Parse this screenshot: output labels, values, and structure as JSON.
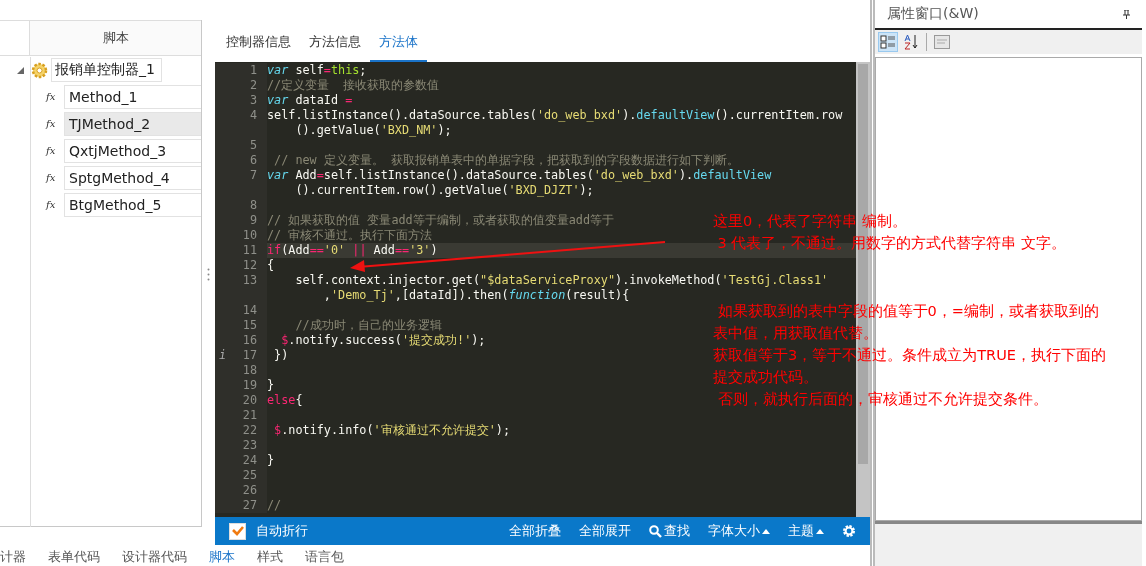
{
  "left_panel": {
    "header": "脚本",
    "tree": {
      "label": "报销单控制器_1",
      "expanded": true,
      "children": [
        {
          "icon": "fx",
          "label": "Method_1",
          "selected": false
        },
        {
          "icon": "fx",
          "label": "TJMethod_2",
          "selected": true
        },
        {
          "icon": "fx",
          "label": "QxtjMethod_3",
          "selected": false
        },
        {
          "icon": "fx",
          "label": "SptgMethod_4",
          "selected": false
        },
        {
          "icon": "fx",
          "label": "BtgMethod_5",
          "selected": false
        }
      ]
    }
  },
  "tabs": [
    {
      "label": "控制器信息",
      "selected": false
    },
    {
      "label": "方法信息",
      "selected": false
    },
    {
      "label": "方法体",
      "selected": true
    }
  ],
  "editor": {
    "lines": [
      {
        "no": "1",
        "current": false,
        "rows": [
          {
            "tokens": [
              {
                "kind": "kw",
                "text": "var"
              },
              {
                "kind": "plain",
                "text": " self"
              },
              {
                "kind": "op",
                "text": "="
              },
              {
                "kind": "special",
                "text": "this"
              },
              {
                "kind": "plain",
                "text": ";"
              }
            ]
          }
        ]
      },
      {
        "no": "2",
        "current": false,
        "rows": [
          {
            "tokens": [
              {
                "kind": "comment",
                "text": "//定义变量  接收获取的参数值"
              }
            ]
          }
        ]
      },
      {
        "no": "3",
        "current": false,
        "rows": [
          {
            "tokens": [
              {
                "kind": "kw",
                "text": "var"
              },
              {
                "kind": "plain",
                "text": " dataId "
              },
              {
                "kind": "op",
                "text": "="
              }
            ]
          }
        ]
      },
      {
        "no": "4",
        "current": false,
        "rows": [
          {
            "tokens": [
              {
                "kind": "plain",
                "text": "self.listInstance().dataSource.tables("
              },
              {
                "kind": "str",
                "text": "'do_web_bxd'"
              },
              {
                "kind": "plain",
                "text": ")."
              },
              {
                "kind": "fn",
                "text": "defaultView"
              },
              {
                "kind": "plain",
                "text": "().currentItem.row"
              }
            ]
          },
          {
            "tokens": [
              {
                "kind": "plain",
                "text": "    ().getValue("
              },
              {
                "kind": "str",
                "text": "'BXD_NM'"
              },
              {
                "kind": "plain",
                "text": ");"
              }
            ]
          }
        ]
      },
      {
        "no": "5",
        "current": false,
        "rows": [
          {}
        ]
      },
      {
        "no": "6",
        "current": false,
        "rows": [
          {
            "tokens": [
              {
                "kind": "comment",
                "text": " // new 定义变量。 获取报销单表中的单据字段，把获取到的字段数据进行如下判断。"
              }
            ]
          }
        ]
      },
      {
        "no": "7",
        "current": false,
        "rows": [
          {
            "tokens": [
              {
                "kind": "kw",
                "text": "var"
              },
              {
                "kind": "plain",
                "text": " Add"
              },
              {
                "kind": "op",
                "text": "="
              },
              {
                "kind": "plain",
                "text": "self.listInstance().dataSource.tables("
              },
              {
                "kind": "str",
                "text": "'do_web_bxd'"
              },
              {
                "kind": "plain",
                "text": ")."
              },
              {
                "kind": "fn",
                "text": "defaultView"
              }
            ]
          },
          {
            "tokens": [
              {
                "kind": "plain",
                "text": "    ().currentItem.row().getValue("
              },
              {
                "kind": "str",
                "text": "'BXD_DJZT'"
              },
              {
                "kind": "plain",
                "text": ");"
              }
            ]
          }
        ]
      },
      {
        "no": "8",
        "current": false,
        "rows": [
          {}
        ]
      },
      {
        "no": "9",
        "current": false,
        "rows": [
          {
            "tokens": [
              {
                "kind": "comment",
                "text": "// 如果获取的值 变量add等于编制，或者获取的值变量add等于"
              }
            ]
          }
        ]
      },
      {
        "no": "10",
        "current": false,
        "rows": [
          {
            "tokens": [
              {
                "kind": "comment",
                "text": "// 审核不通过。执行下面方法"
              }
            ]
          }
        ]
      },
      {
        "no": "11",
        "current": true,
        "rows": [
          {
            "tokens": [
              {
                "kind": "op",
                "text": "if"
              },
              {
                "kind": "plain",
                "text": "(Add"
              },
              {
                "kind": "op",
                "text": "=="
              },
              {
                "kind": "str",
                "text": "'0'"
              },
              {
                "kind": "op",
                "text": " ||"
              },
              {
                "kind": "plain",
                "text": " Add"
              },
              {
                "kind": "op",
                "text": "=="
              },
              {
                "kind": "str",
                "text": "'3'"
              },
              {
                "kind": "plain",
                "text": ")"
              }
            ]
          }
        ]
      },
      {
        "no": "12",
        "current": false,
        "rows": [
          {
            "tokens": [
              {
                "kind": "plain",
                "text": "{"
              }
            ]
          }
        ]
      },
      {
        "no": "13",
        "current": false,
        "rows": [
          {
            "tokens": [
              {
                "kind": "plain",
                "text": "    self.context.injector.get("
              },
              {
                "kind": "str",
                "text": "\"$dataServiceProxy\""
              },
              {
                "kind": "plain",
                "text": ").invokeMethod("
              },
              {
                "kind": "str",
                "text": "'TestGj.Class1'"
              }
            ]
          },
          {
            "tokens": [
              {
                "kind": "plain",
                "text": "        ,"
              },
              {
                "kind": "str",
                "text": "'Demo_Tj'"
              },
              {
                "kind": "plain",
                "text": ",[dataId]).then("
              },
              {
                "kind": "kwi",
                "text": "function"
              },
              {
                "kind": "plain",
                "text": "(result){"
              }
            ]
          }
        ]
      },
      {
        "no": "14",
        "current": false,
        "rows": [
          {}
        ]
      },
      {
        "no": "15",
        "current": false,
        "rows": [
          {
            "tokens": [
              {
                "kind": "comment",
                "text": "    //成功时，自己的业务逻辑"
              }
            ]
          }
        ]
      },
      {
        "no": "16",
        "current": false,
        "rows": [
          {
            "tokens": [
              {
                "kind": "op",
                "text": "  $"
              },
              {
                "kind": "plain",
                "text": ".notify.success("
              },
              {
                "kind": "str",
                "text": "'提交成功!'"
              },
              {
                "kind": "plain",
                "text": ");"
              }
            ]
          }
        ]
      },
      {
        "no": "17",
        "current": false,
        "marker": "i",
        "rows": [
          {
            "tokens": [
              {
                "kind": "plain",
                "text": " })"
              }
            ]
          }
        ]
      },
      {
        "no": "18",
        "current": false,
        "rows": [
          {}
        ]
      },
      {
        "no": "19",
        "current": false,
        "rows": [
          {
            "tokens": [
              {
                "kind": "plain",
                "text": "}"
              }
            ]
          }
        ]
      },
      {
        "no": "20",
        "current": false,
        "rows": [
          {
            "tokens": [
              {
                "kind": "op",
                "text": "else"
              },
              {
                "kind": "plain",
                "text": "{"
              }
            ]
          }
        ]
      },
      {
        "no": "21",
        "current": false,
        "rows": [
          {}
        ]
      },
      {
        "no": "22",
        "current": false,
        "rows": [
          {
            "tokens": [
              {
                "kind": "op",
                "text": " $"
              },
              {
                "kind": "plain",
                "text": ".notify.info("
              },
              {
                "kind": "str",
                "text": "'审核通过不允许提交'"
              },
              {
                "kind": "plain",
                "text": ");"
              }
            ]
          }
        ]
      },
      {
        "no": "23",
        "current": false,
        "rows": [
          {}
        ]
      },
      {
        "no": "24",
        "current": false,
        "rows": [
          {
            "tokens": [
              {
                "kind": "plain",
                "text": "}"
              }
            ]
          }
        ]
      },
      {
        "no": "25",
        "current": false,
        "rows": [
          {}
        ]
      },
      {
        "no": "26",
        "current": false,
        "rows": [
          {}
        ]
      },
      {
        "no": "27",
        "current": false,
        "rows": [
          {
            "tokens": [
              {
                "kind": "comment",
                "text": "//"
              }
            ]
          }
        ]
      }
    ]
  },
  "editor_toolbar": {
    "word_wrap": {
      "label": "自动折行",
      "checked": true
    },
    "buttons": [
      {
        "label": "全部折叠",
        "kind": "text"
      },
      {
        "label": "全部展开",
        "kind": "text"
      },
      {
        "label": "查找",
        "kind": "search"
      },
      {
        "label": "字体大小",
        "kind": "menu"
      },
      {
        "label": "主题",
        "kind": "menu"
      },
      {
        "kind": "settings"
      }
    ]
  },
  "annotations": [
    {
      "lines": [
        "这里0，代表了字符串 编制。",
        " 3 代表了，不通过。用数字的方式代替字符串 文字。"
      ]
    },
    {
      "lines": [
        " 如果获取到的表中字段的值等于0，=编制，或者获取到的",
        "表中值，用获取值代替。",
        "获取值等于3，等于不通过。条件成立为TRUE，执行下面的",
        "提交成功代码。",
        " 否则，就执行后面的，审核通过不允许提交条件。"
      ]
    }
  ],
  "bottom_tabs": [
    {
      "label": "计器",
      "selected": false
    },
    {
      "label": "表单代码",
      "selected": false
    },
    {
      "label": "设计器代码",
      "selected": false
    },
    {
      "label": "脚本",
      "selected": true
    },
    {
      "label": "样式",
      "selected": false
    },
    {
      "label": "语言包",
      "selected": false
    }
  ],
  "properties_panel": {
    "title": "属性窗口(&W)",
    "toolbar": [
      {
        "kind": "categorized",
        "selected": true
      },
      {
        "kind": "alphabetical",
        "selected": false
      },
      {
        "kind": "pages",
        "selected": false
      }
    ]
  }
}
